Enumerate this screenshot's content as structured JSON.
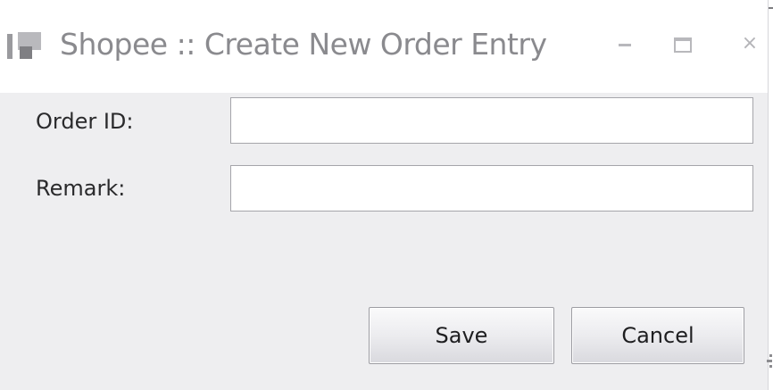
{
  "window": {
    "title": "Shopee :: Create New Order Entry",
    "icon": "app-icon",
    "controls": {
      "minimize": "minimize-icon",
      "maximize": "maximize-icon",
      "close": "×"
    }
  },
  "form": {
    "order_id": {
      "label": "Order ID:",
      "value": "",
      "placeholder": ""
    },
    "remark": {
      "label": "Remark:",
      "value": "",
      "placeholder": ""
    }
  },
  "buttons": {
    "save": "Save",
    "cancel": "Cancel"
  },
  "colors": {
    "window_bg": "#eeeef0",
    "title_text": "#8a8a8e",
    "field_border": "#a5a5aa"
  }
}
